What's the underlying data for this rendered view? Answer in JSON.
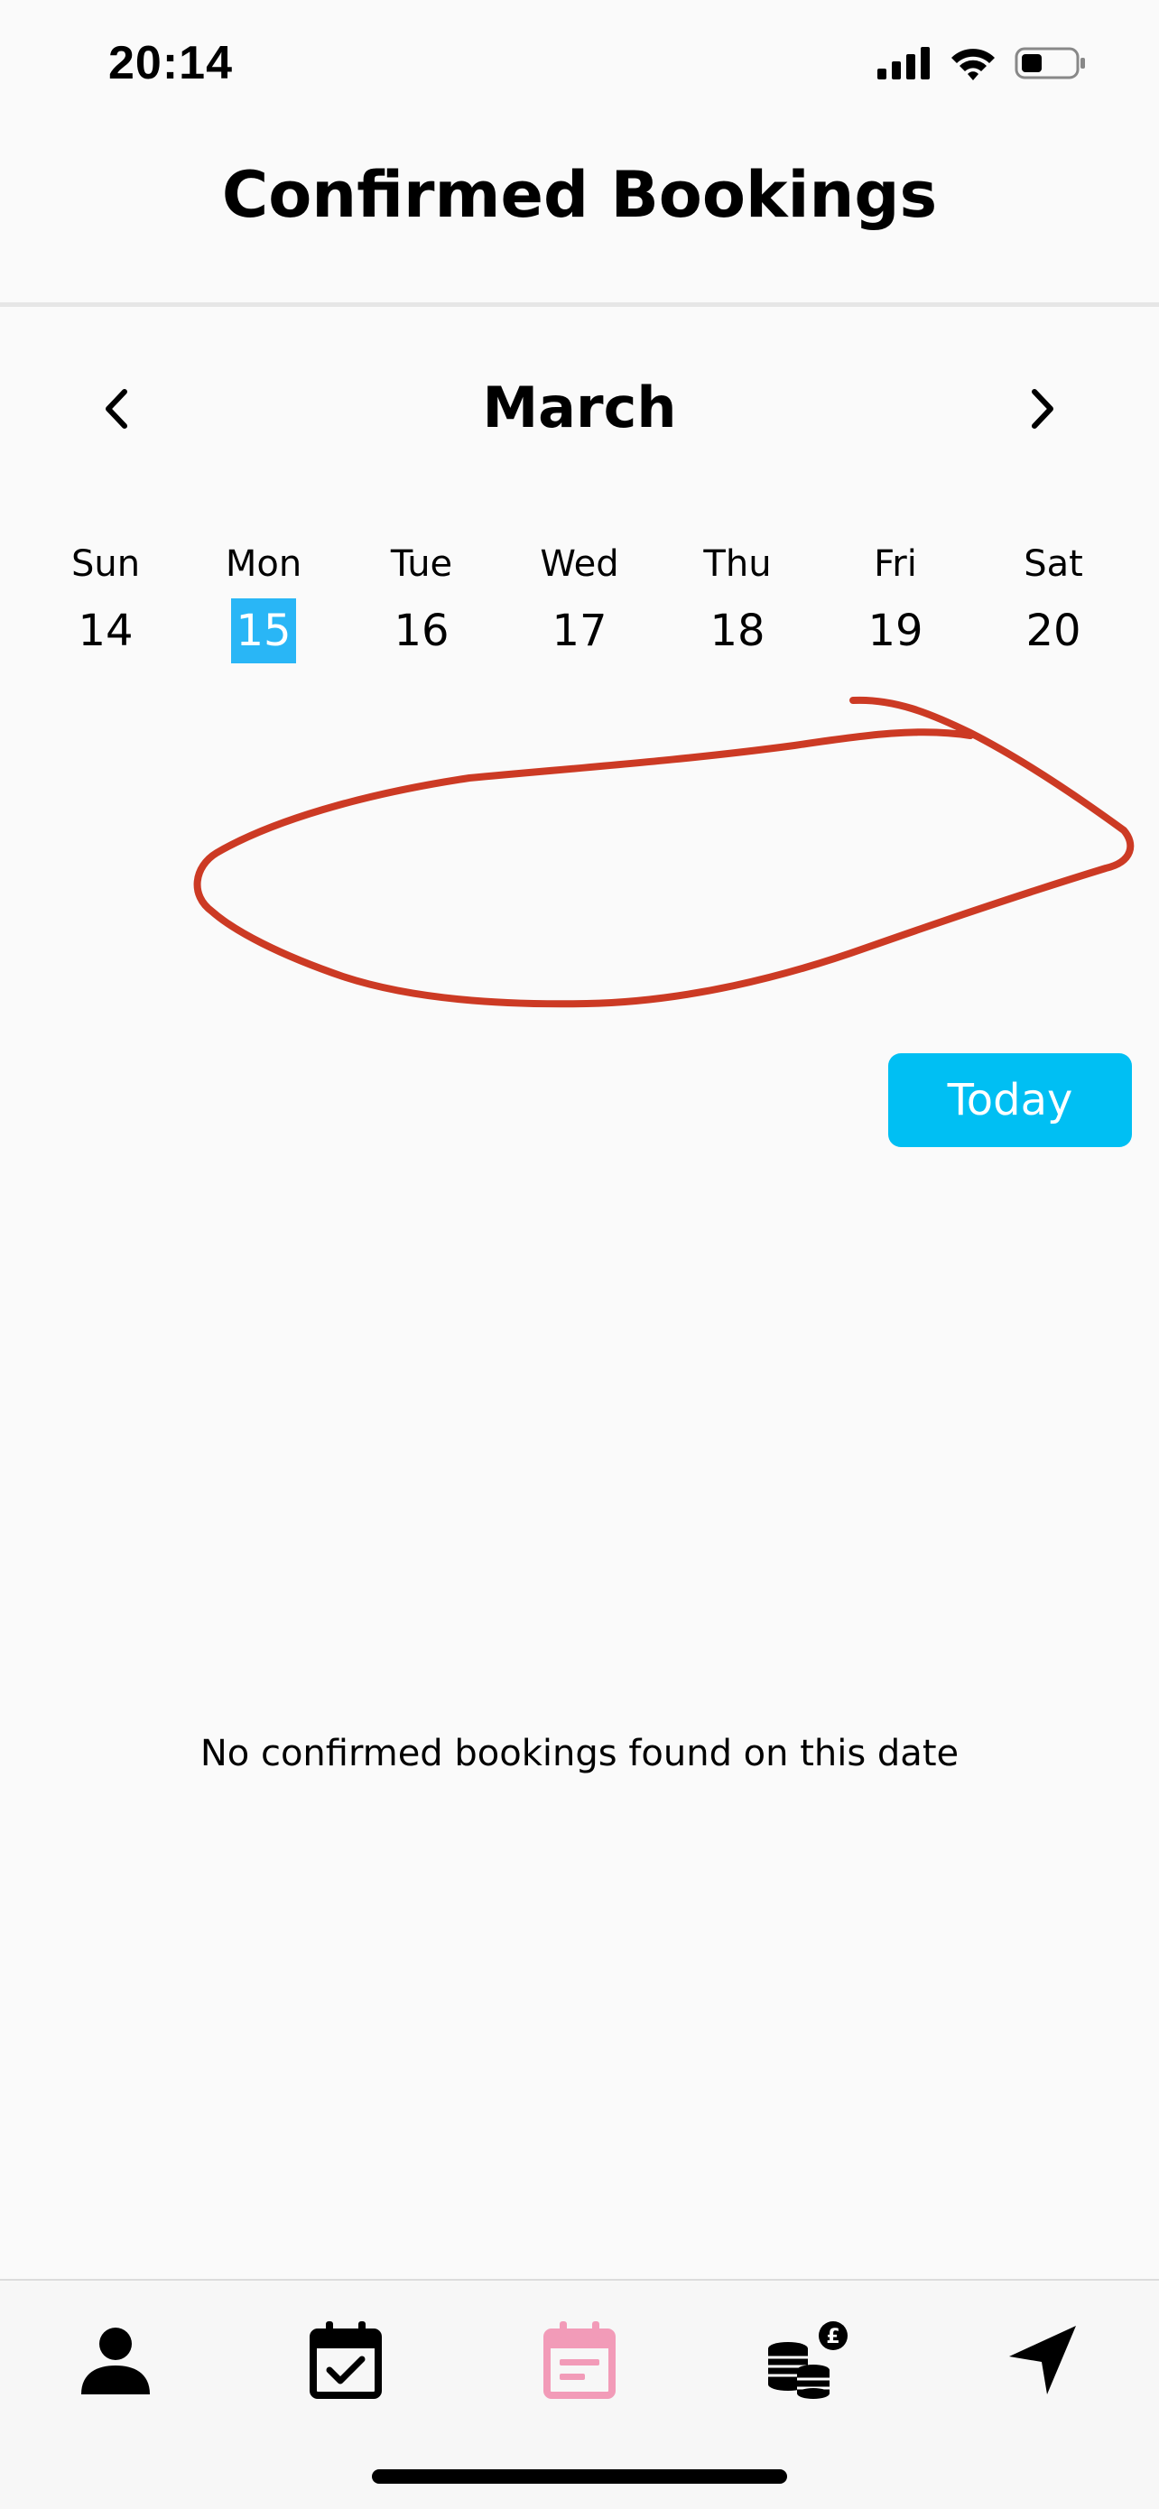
{
  "status_bar": {
    "time": "20:14",
    "icons": [
      "signal-icon",
      "wifi-icon",
      "battery-icon"
    ]
  },
  "header": {
    "title": "Confirmed Bookings"
  },
  "calendar": {
    "month": "March",
    "prev_icon": "chevron-left-icon",
    "next_icon": "chevron-right-icon",
    "days": [
      {
        "name": "Sun",
        "date": "14"
      },
      {
        "name": "Mon",
        "date": "15",
        "selected": true
      },
      {
        "name": "Tue",
        "date": "16"
      },
      {
        "name": "Wed",
        "date": "17"
      },
      {
        "name": "Thu",
        "date": "18"
      },
      {
        "name": "Fri",
        "date": "19"
      },
      {
        "name": "Sat",
        "date": "20"
      }
    ],
    "selected_color": "#29b6f6"
  },
  "today_button": {
    "label": "Today",
    "color": "#00bff3"
  },
  "empty_state": {
    "message": "No confirmed bookings found on this date"
  },
  "annotation": {
    "shape": "freehand-loop",
    "color": "#cc3a24"
  },
  "tabbar": {
    "tabs": [
      {
        "icon": "person-icon",
        "active": false
      },
      {
        "icon": "calendar-check-icon",
        "active": false
      },
      {
        "icon": "calendar-list-icon",
        "active": true
      },
      {
        "icon": "coins-pound-icon",
        "active": false
      },
      {
        "icon": "navigation-arrow-icon",
        "active": false
      }
    ],
    "active_color": "#f29bb8"
  }
}
